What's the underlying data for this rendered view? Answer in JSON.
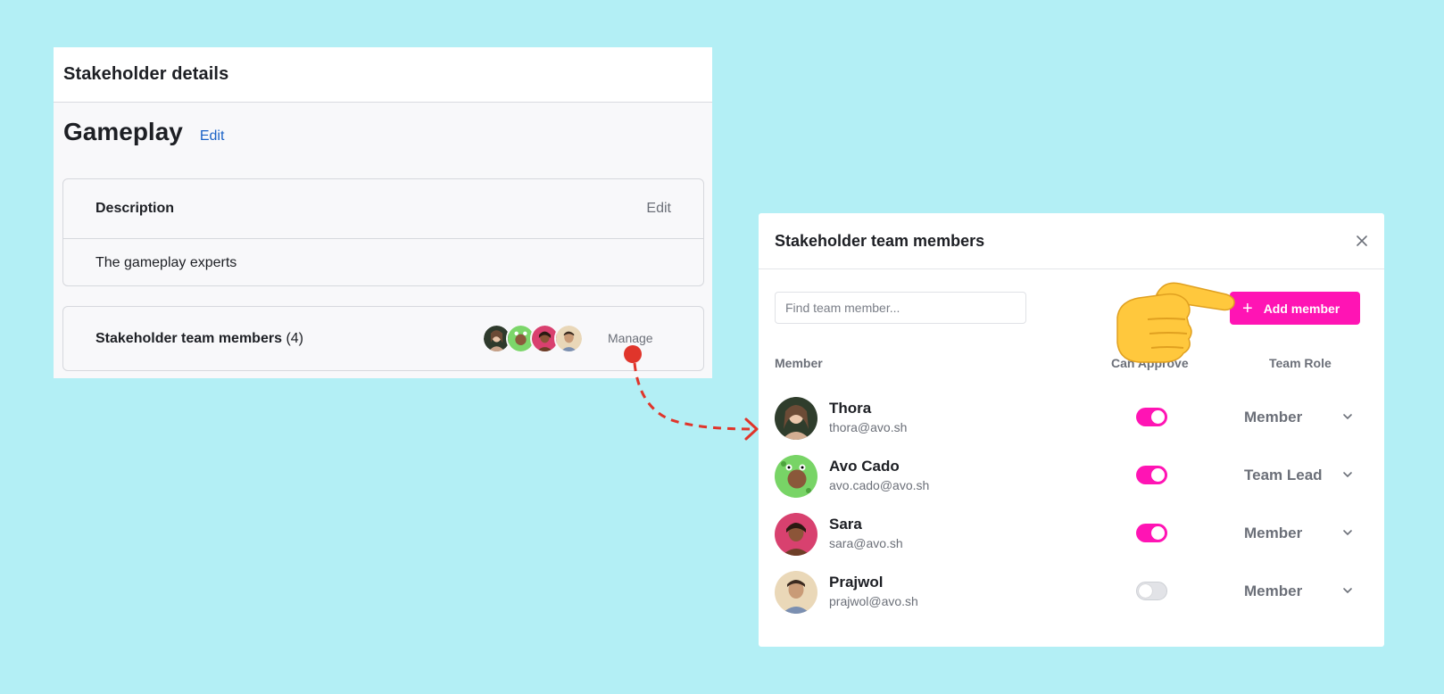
{
  "details": {
    "header_title": "Stakeholder details",
    "group_name": "Gameplay",
    "edit_label": "Edit",
    "description": {
      "label": "Description",
      "edit_label": "Edit",
      "text": "The gameplay experts"
    },
    "members": {
      "label": "Stakeholder team members",
      "count": "(4)",
      "manage_label": "Manage",
      "avatars": [
        "thora-avatar",
        "avo-cado-avatar",
        "sara-avatar",
        "prajwol-avatar"
      ]
    }
  },
  "modal": {
    "title": "Stakeholder team members",
    "search_placeholder": "Find team member...",
    "add_button_label": "Add member",
    "columns": {
      "member": "Member",
      "can_approve": "Can Approve",
      "team_role": "Team Role"
    },
    "members": [
      {
        "name": "Thora",
        "email": "thora@avo.sh",
        "can_approve": true,
        "role": "Member"
      },
      {
        "name": "Avo Cado",
        "email": "avo.cado@avo.sh",
        "can_approve": true,
        "role": "Team Lead"
      },
      {
        "name": "Sara",
        "email": "sara@avo.sh",
        "can_approve": true,
        "role": "Member"
      },
      {
        "name": "Prajwol",
        "email": "prajwol@avo.sh",
        "can_approve": false,
        "role": "Member"
      }
    ]
  },
  "colors": {
    "background": "#b3eff5",
    "accent": "#ff14b4",
    "link": "#1a62c7",
    "arrow": "#e0352b"
  },
  "icons": [
    "close-icon",
    "plus-icon",
    "chevron-down-icon",
    "pointing-hand-icon",
    "arrow-right-icon"
  ]
}
